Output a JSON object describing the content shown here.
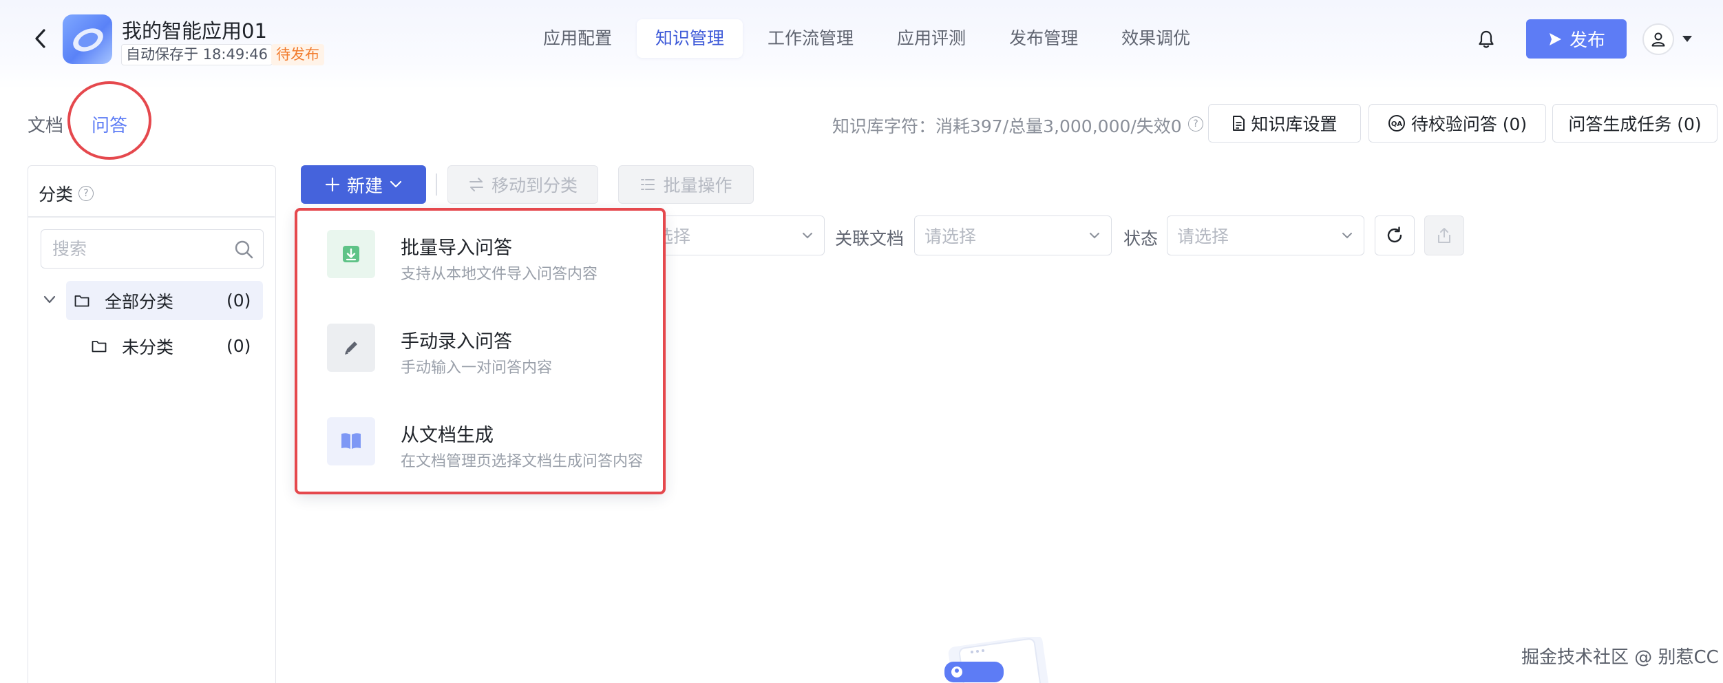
{
  "header": {
    "app_title": "我的智能应用01",
    "autosave": "自动保存于 18:49:46",
    "status": "待发布",
    "nav_tabs": [
      {
        "label": "应用配置",
        "active": false
      },
      {
        "label": "知识管理",
        "active": true
      },
      {
        "label": "工作流管理",
        "active": false
      },
      {
        "label": "应用评测",
        "active": false
      },
      {
        "label": "发布管理",
        "active": false
      },
      {
        "label": "效果调优",
        "active": false
      }
    ],
    "publish_label": "发布"
  },
  "subtabs": {
    "doc": "文档",
    "qa": "问答",
    "active": "问答"
  },
  "kb_bar": {
    "info": "知识库字符：消耗397/总量3,000,000/失效0",
    "settings_label": "知识库设置",
    "pending_label": "待校验问答 (0)",
    "tasks_label": "问答生成任务 (0)"
  },
  "sidebar": {
    "title": "分类",
    "search_placeholder": "搜索",
    "tree": [
      {
        "label": "全部分类",
        "count": "(0)",
        "expanded": true,
        "selected": true
      },
      {
        "label": "未分类",
        "count": "(0)",
        "expanded": false,
        "selected": false
      }
    ]
  },
  "toolbar": {
    "new_label": "新建",
    "move_label": "移动到分类",
    "batch_label": "批量操作"
  },
  "filters": {
    "first_select_partial": "选择",
    "related_doc_label": "关联文档",
    "related_doc_placeholder": "请选择",
    "status_label": "状态",
    "status_placeholder": "请选择"
  },
  "new_menu": {
    "items": [
      {
        "title": "批量导入问答",
        "desc": "支持从本地文件导入问答内容",
        "icon": "import-icon"
      },
      {
        "title": "手动录入问答",
        "desc": "手动输入一对问答内容",
        "icon": "pencil-icon"
      },
      {
        "title": "从文档生成",
        "desc": "在文档管理页选择文档生成问答内容",
        "icon": "book-icon"
      }
    ]
  },
  "watermark": "掘金技术社区 @ 别惹CC",
  "colors": {
    "primary": "#4563dc",
    "publish": "#5d7cf5",
    "accent_text": "#3f5bd8",
    "status_orange": "#f27c2e",
    "highlight_red": "#e5484d"
  }
}
